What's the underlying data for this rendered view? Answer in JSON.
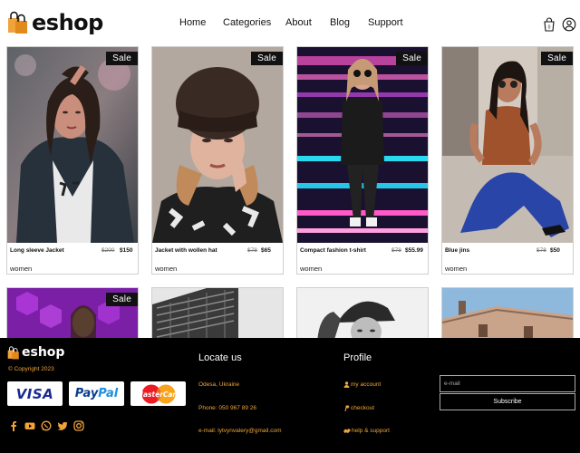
{
  "header": {
    "brand": "eshop",
    "nav": [
      "Home",
      "Categories",
      "About",
      "Blog",
      "Support"
    ],
    "cart_count": "0",
    "icons": [
      "cart-icon",
      "user-icon"
    ]
  },
  "products": [
    {
      "sale": "Sale",
      "name": "Long sleeve Jacket",
      "old_price": "$200",
      "price": "$150",
      "category": "women"
    },
    {
      "sale": "Sale",
      "name": "Jacket with wollen hat",
      "old_price": "$78",
      "price": "$65",
      "category": "women"
    },
    {
      "sale": "Sale",
      "name": "Compact fashion t-shirt",
      "old_price": "$78",
      "price": "$55.99",
      "category": "women"
    },
    {
      "sale": "Sale",
      "name": "Blue jins",
      "old_price": "$78",
      "price": "$50",
      "category": "women"
    }
  ],
  "partial_products": [
    {
      "sale": "Sale"
    }
  ],
  "footer": {
    "brand": "eshop",
    "copyright": "© Copyright 2023",
    "payments": {
      "visa": "VISA",
      "paypal_a": "Pay",
      "paypal_b": "Pal",
      "mastercard": "MasterCard"
    },
    "socials": [
      "facebook-icon",
      "youtube-icon",
      "whatsapp-icon",
      "twitter-icon",
      "instagram-icon"
    ],
    "locate": {
      "title": "Locate us",
      "address": "Odesa, Ukraine",
      "phone": "Phone: 050 967 89 26",
      "email": "e-mail: lytvynvalery@gmail.com"
    },
    "profile": {
      "title": "Profile",
      "items": [
        "my account",
        "checkout",
        "help & support"
      ]
    },
    "newsletter": {
      "placeholder": "e-mail",
      "button": "Subscribe"
    }
  },
  "colors": {
    "accent": "#f0a33a",
    "footer_bg": "#000000",
    "sale_bg": "#111111"
  }
}
